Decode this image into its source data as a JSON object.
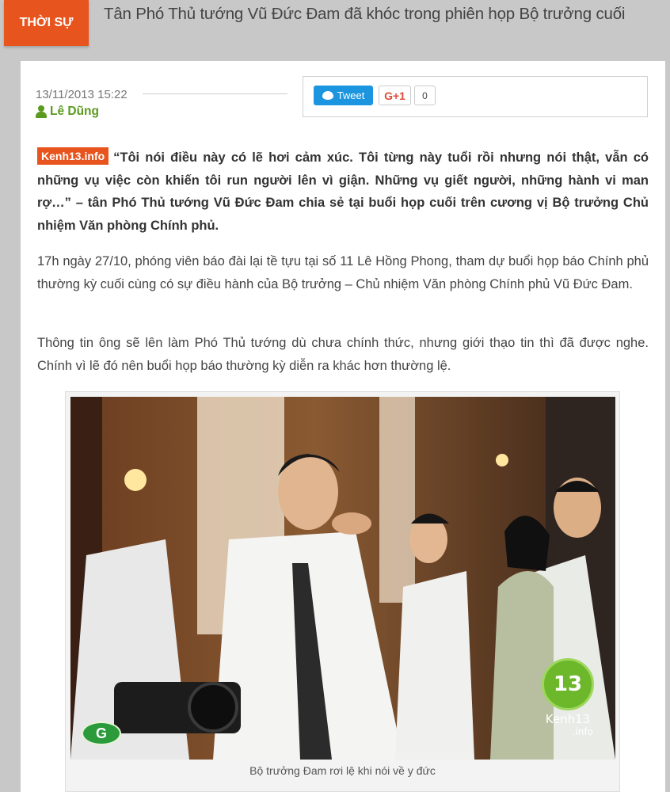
{
  "header": {
    "category": "THỜI SỰ",
    "headline": "Tân Phó Thủ tướng Vũ Đức Đam đã khóc trong phiên họp Bộ trưởng cuối"
  },
  "meta": {
    "date": "13/11/2013 15:22",
    "author": "Lê Dũng"
  },
  "share": {
    "tweet_label": "Tweet",
    "gplus_label": "G+1",
    "gplus_count": "0"
  },
  "article": {
    "source_tag": "Kenh13.info",
    "lead": "“Tôi nói điều này có lẽ hơi cảm xúc. Tôi từng này tuổi rồi nhưng nói thật, vẫn có những vụ việc còn khiến tôi run người lên vì giận. Những vụ giết người, những hành vi man rợ…” – tân Phó Thủ tướng Vũ Đức Đam chia sẻ tại buổi họp cuối trên cương vị Bộ trưởng Chủ nhiệm Văn phòng Chính phủ.",
    "paragraphs": [
      "17h ngày 27/10, phóng viên báo đài lại tề tựu tại số 11 Lê Hồng Phong, tham dự buổi họp báo Chính phủ thường kỳ cuối cùng có sự điều hành của Bộ trưởng – Chủ nhiệm Văn phòng Chính phủ Vũ Đức Đam.",
      "Thông tin ông sẽ lên làm Phó Thủ tướng dù chưa chính thức, nhưng giới thạo tin thì đã được nghe. Chính vì lẽ đó nên buổi họp báo thường kỳ diễn ra khác hơn thường lệ."
    ],
    "figure": {
      "watermark": "Kenh13",
      "watermark_sub": ".info",
      "watermark_badge": "13",
      "corner_logo": "G",
      "caption": "Bộ trưởng Đam rơi lệ khi nói về y đức"
    }
  },
  "colors": {
    "accent": "#e8541d",
    "author": "#5a9a1f",
    "twitter": "#1b95e0",
    "gplus": "#dd4b39"
  }
}
